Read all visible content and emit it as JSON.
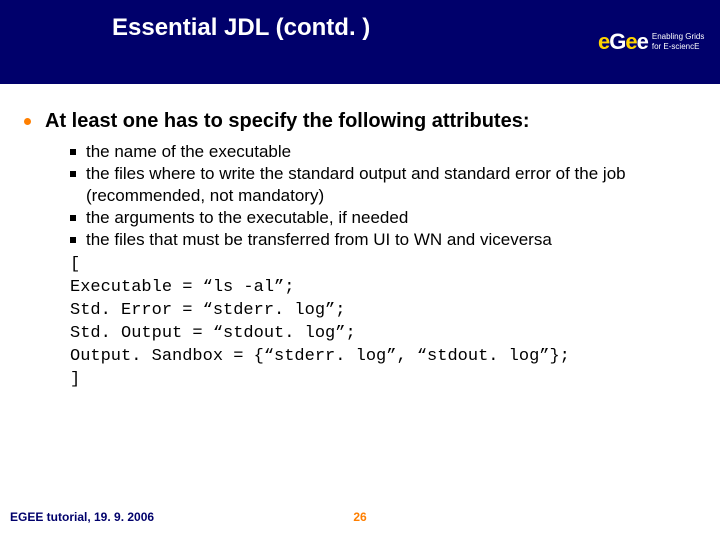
{
  "header": {
    "title": "Essential JDL (contd. )",
    "logo_text": "eGee",
    "logo_tagline_1": "Enabling Grids",
    "logo_tagline_2": "for E-sciencE"
  },
  "main_bullet": "At least one has to specify the following attributes:",
  "subbullets": {
    "b1": "the name of the executable",
    "b2": "the files where to write the standard output and standard error of the job (recommended, not mandatory)",
    "b3": "the arguments to the executable, if needed",
    "b4": "the files that must be transferred from UI to WN and viceversa"
  },
  "code": {
    "l1": "[",
    "l2": "Executable = “ls -al”;",
    "l3": "Std. Error = “stderr. log”;",
    "l4": "Std. Output = “stdout. log”;",
    "l5": "Output. Sandbox = {“stderr. log”, “stdout. log”};",
    "l6": "]"
  },
  "footer": {
    "left": "EGEE tutorial, 19. 9. 2006",
    "page": "26"
  }
}
